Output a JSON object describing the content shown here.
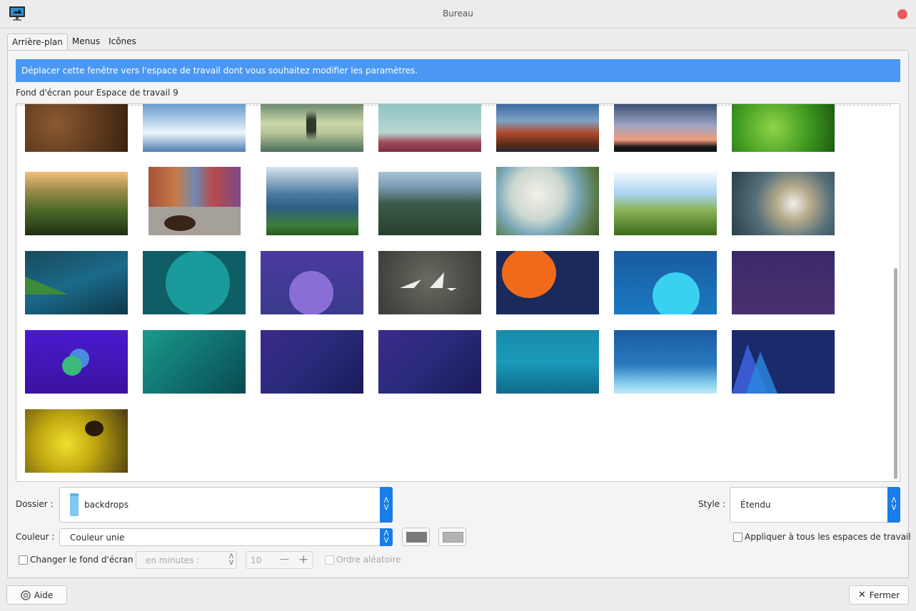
{
  "window": {
    "title": "Bureau"
  },
  "tabs": [
    {
      "label": "Arrière-plan",
      "active": true
    },
    {
      "label": "Menus",
      "active": false
    },
    {
      "label": "Icônes",
      "active": false
    }
  ],
  "info_bar": {
    "text": "Déplacer cette fenêtre vers l'espace de travail dont vous souhaitez modifier les paramètres.",
    "color": "#4a98f3"
  },
  "gallery": {
    "label": "Fond d'écran pour Espace de travail 9",
    "rows": [
      [
        "brown rock texture",
        "clouds above sky",
        "tree reflection in lake",
        "mountain ridge at dusk",
        "red rock formation",
        "bare tree at sunset",
        "green leaf with droplet"
      ],
      [
        "grass at sunset bokeh",
        "cat in colorful alley",
        "rock arch over sea",
        "cabin in mountain valley",
        "white flowers by lake",
        "wheat field with sun",
        "white blossoms on branch"
      ],
      [
        "blue green abstract",
        "teal circle with curves",
        "purple circle with curves",
        "origami boats on grey",
        "orange sun with waves",
        "blue planet with curve",
        "purple night sky"
      ],
      [
        "purple with green bubbles",
        "teal geometric",
        "violet with comet",
        "violet with comet",
        "teal waves",
        "blue waves",
        "blue triangles at night"
      ],
      [
        "bee on yellow flower"
      ]
    ]
  },
  "folder": {
    "label": "Dossier :",
    "value": "backdrops"
  },
  "style": {
    "label": "Style :",
    "value": "Étendu"
  },
  "color": {
    "label": "Couleur :",
    "value": "Couleur unie",
    "primary": "#7a7a7a",
    "secondary": "#b3b3b3"
  },
  "apply_all": {
    "label": "Appliquer à tous les espaces de travail",
    "checked": false
  },
  "change_bg": {
    "label": "Changer le fond d'écran",
    "checked": false,
    "interval_placeholder": "en minutes :",
    "interval_value": "10",
    "minus": "—",
    "plus": "+",
    "random_label": "Ordre aléatoire"
  },
  "buttons": {
    "help": "Aide",
    "close": "Fermer"
  }
}
